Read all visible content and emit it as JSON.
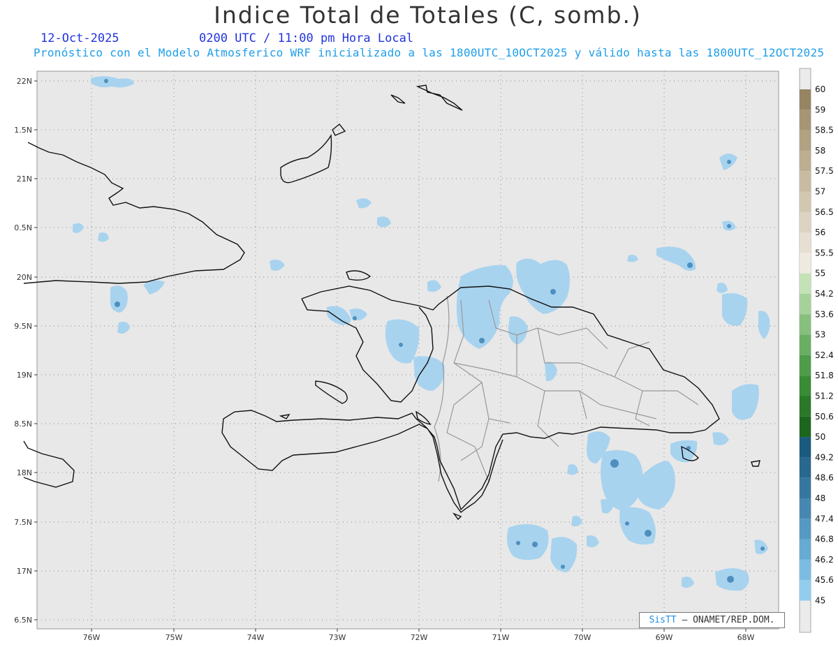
{
  "header": {
    "title": "Indice Total de Totales (C, somb.)",
    "date": "12-Oct-2025",
    "time": "0200 UTC / 11:00 pm Hora Local",
    "subtitle": "Pronóstico con el Modelo Atmosferico WRF inicializado a las 1800UTC_10OCT2025 y válido hasta las  1800UTC_12OCT2025"
  },
  "axes": {
    "lon_labels": [
      "76W",
      "75W",
      "74W",
      "73W",
      "72W",
      "71W",
      "70W",
      "69W",
      "68W"
    ],
    "lat_labels": [
      "22N",
      "1.5N",
      "21N",
      "0.5N",
      "20N",
      "9.5N",
      "19N",
      "8.5N",
      "18N",
      "7.5N",
      "17N",
      "6.5N"
    ]
  },
  "colorbar": {
    "levels": [
      "60",
      "59",
      "58.5",
      "58",
      "57.5",
      "57",
      "56.5",
      "56",
      "55.5",
      "55",
      "54.2",
      "53.6",
      "53",
      "52.4",
      "51.8",
      "51.2",
      "50.6",
      "50",
      "49.2",
      "48.6",
      "48",
      "47.4",
      "46.8",
      "46.2",
      "45.6",
      "45"
    ],
    "colors": [
      "#968462",
      "#a69574",
      "#b2a282",
      "#bdae91",
      "#c8bba1",
      "#d2c7b1",
      "#dcd3c1",
      "#e6dfd2",
      "#efeae1",
      "#c4e2b8",
      "#a5d19a",
      "#87bf7d",
      "#69ae62",
      "#4f9d4a",
      "#3a8b36",
      "#2a7928",
      "#1d661d",
      "#1a5a7c",
      "#28688f",
      "#3677a0",
      "#4688b1",
      "#5699c2",
      "#67aad2",
      "#7cbce2",
      "#92cdee",
      "#ababab"
    ]
  },
  "credit": {
    "brand": "SisTT",
    "org": "– ONAMET/REP.DOM."
  }
}
